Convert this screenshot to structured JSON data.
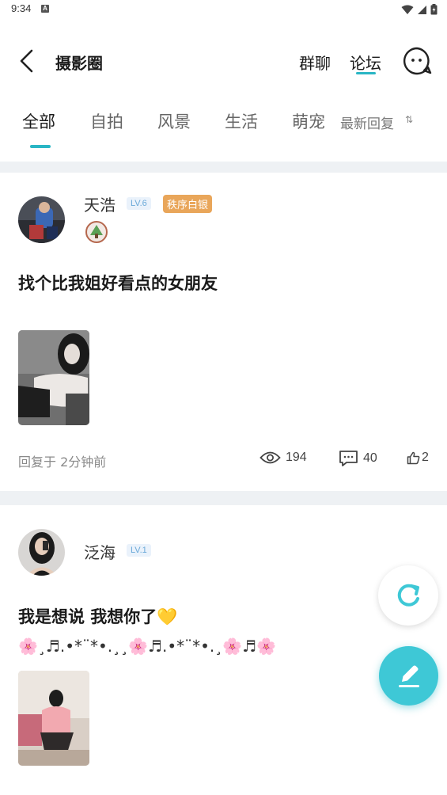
{
  "status_bar": {
    "time": "9:34",
    "notif_letter": "A"
  },
  "header": {
    "title": "摄影圈",
    "tabs": [
      {
        "label": "群聊"
      },
      {
        "label": "论坛"
      }
    ],
    "active_tab": "论坛"
  },
  "categories": {
    "tabs": [
      {
        "label": "全部"
      },
      {
        "label": "自拍"
      },
      {
        "label": "风景"
      },
      {
        "label": "生活"
      },
      {
        "label": "萌宠"
      }
    ],
    "active": "全部",
    "sort_label": "最新回复"
  },
  "posts": [
    {
      "username": "天浩",
      "level": "LV.6",
      "rank": "秩序白银",
      "title": "找个比我姐好看点的女朋友",
      "reply_time": "回复于 2分钟前",
      "views": "194",
      "comments": "40",
      "likes": "2"
    },
    {
      "username": "泛海",
      "level": "LV.1",
      "title": "我是想说 我想你了💛",
      "subtitle": "🌸¸♬.•*¨*•.¸¸🌸♬.•*¨*•.¸🌸♬🌸"
    }
  ],
  "colors": {
    "accent": "#2ab6c5",
    "compose_button": "#3ec8d6",
    "rank_badge": "#e9a65a",
    "level_badge_text": "#6aa9d8",
    "separator": "#eef1f4"
  }
}
